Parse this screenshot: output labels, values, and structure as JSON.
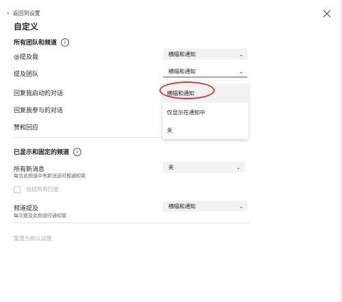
{
  "header": {
    "back_label": "返回到设置",
    "title": "自定义"
  },
  "section_teams": {
    "title": "所有团队和频道",
    "rows": [
      {
        "label": "@提及我",
        "value": "横幅和通知"
      },
      {
        "label": "提及团队",
        "value": "横幅和通知"
      },
      {
        "label": "回复我启动的对话"
      },
      {
        "label": "回复我参与的对话"
      },
      {
        "label": "赞和回应"
      }
    ]
  },
  "dropdown": {
    "options": [
      "横幅和通知",
      "仅显示在通知中",
      "关"
    ],
    "selected": "横幅和通知"
  },
  "section_channels": {
    "title": "已显示和固定的频道",
    "all_messages": {
      "label": "所有新消息",
      "sub": "每当此频道中有新消息时都通知我",
      "value": "关"
    },
    "include_replies": "包括所有回复",
    "channel_mentions": {
      "label": "频道提及",
      "sub": "每次提及此频道时通知我",
      "value": "横幅和通知"
    }
  },
  "footer": {
    "reset_label": "重置为默认设置"
  },
  "icons": {
    "back": "chevron-left-icon",
    "close": "close-icon",
    "info": "info-icon",
    "dropdown": "chevron-down-icon"
  },
  "colors": {
    "accent": "#4f52b2",
    "highlight": "#d63a3a"
  }
}
